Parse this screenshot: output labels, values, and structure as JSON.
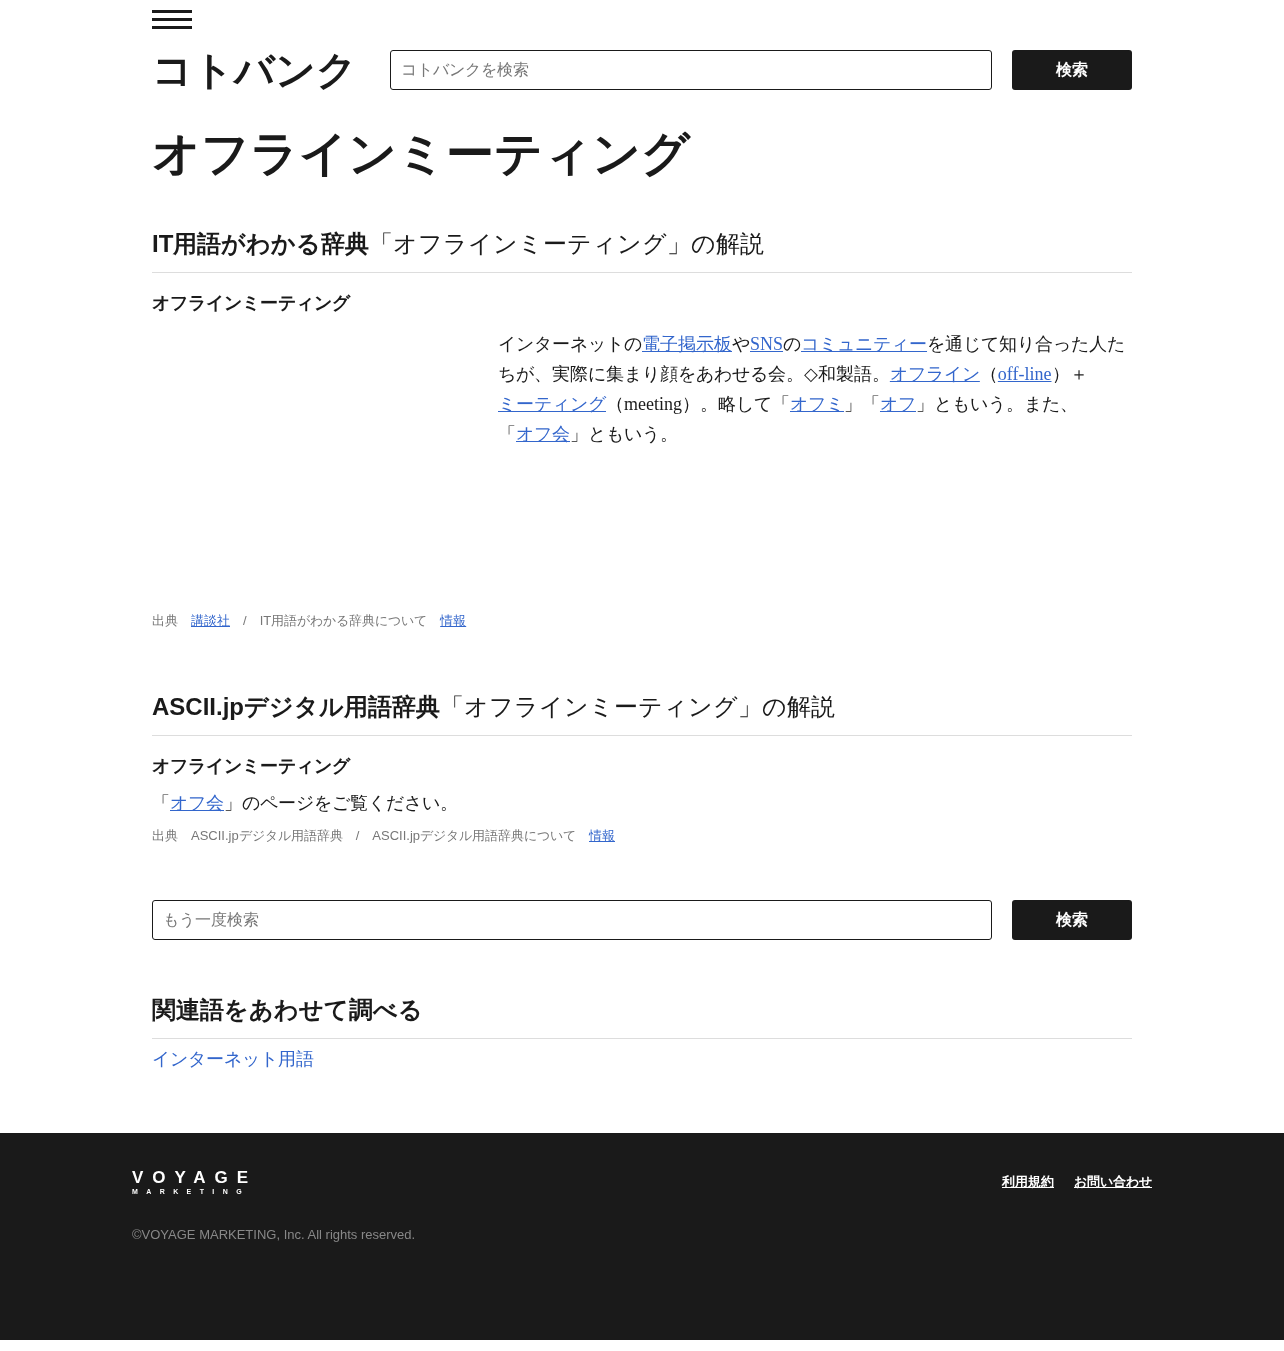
{
  "header": {
    "logo": "コトバンク",
    "search": {
      "placeholder": "コトバンクを検索"
    },
    "search_button": "検索"
  },
  "title": "オフラインミーティング",
  "entries": [
    {
      "heading": "**IT用語がわかる辞典**「オフラインミーティング」の解説",
      "headword": "オフラインミーティング",
      "kind": "long",
      "body": [
        {
          "text": "インターネットの",
          "link": false
        },
        {
          "text": "電子掲示板",
          "link": true
        },
        {
          "text": "や",
          "link": false
        },
        {
          "text": "SNS",
          "link": true
        },
        {
          "text": "の",
          "link": false
        },
        {
          "text": "コミュニティー",
          "link": true
        },
        {
          "text": "を通じて知り合った人たちが、実際に集まり顔をあわせる会。◇和製語。",
          "link": false
        },
        {
          "text": "オフライン",
          "link": true
        },
        {
          "text": "（",
          "link": false
        },
        {
          "text": "off-line",
          "link": true
        },
        {
          "text": "）＋",
          "link": false
        },
        {
          "text": "ミーティング",
          "link": true
        },
        {
          "text": "（meeting）。略して「",
          "link": false
        },
        {
          "text": "オフミ",
          "link": true
        },
        {
          "text": "」「",
          "link": false
        },
        {
          "text": "オフ",
          "link": true
        },
        {
          "text": "」ともいう。また、「",
          "link": false
        },
        {
          "text": "オフ会",
          "link": true
        },
        {
          "text": "」ともいう。",
          "link": false
        }
      ],
      "source": [
        {
          "text": "出典",
          "link": false
        },
        {
          "text": "講談社",
          "link": true
        },
        {
          "text": "/",
          "link": false
        },
        {
          "text": "IT用語がわかる辞典について",
          "link": false
        },
        {
          "text": "情報",
          "link": true
        }
      ]
    },
    {
      "heading": "**ASCII.jpデジタル用語辞典**「オフラインミーティング」の解説",
      "headword": "オフラインミーティング",
      "kind": "short",
      "body": [
        {
          "text": "「",
          "link": false
        },
        {
          "text": "オフ会",
          "link": true
        },
        {
          "text": "」のページをご覧ください。",
          "link": false
        }
      ],
      "source": [
        {
          "text": "出典",
          "link": false
        },
        {
          "text": "ASCII.jpデジタル用語辞典",
          "link": false
        },
        {
          "text": "/",
          "link": false
        },
        {
          "text": "ASCII.jpデジタル用語辞典について",
          "link": false
        },
        {
          "text": "情報",
          "link": true
        }
      ]
    }
  ],
  "search_again": {
    "placeholder": "もう一度検索",
    "button": "検索"
  },
  "related": {
    "heading": "関連語をあわせて調べる",
    "links": [
      "インターネット用語"
    ]
  },
  "footer": {
    "logo_top": "VOYAGE",
    "logo_bottom": "MARKETING",
    "links": [
      "利用規約",
      "お問い合わせ"
    ],
    "copyright": "©VOYAGE MARKETING, Inc. All rights reserved."
  }
}
